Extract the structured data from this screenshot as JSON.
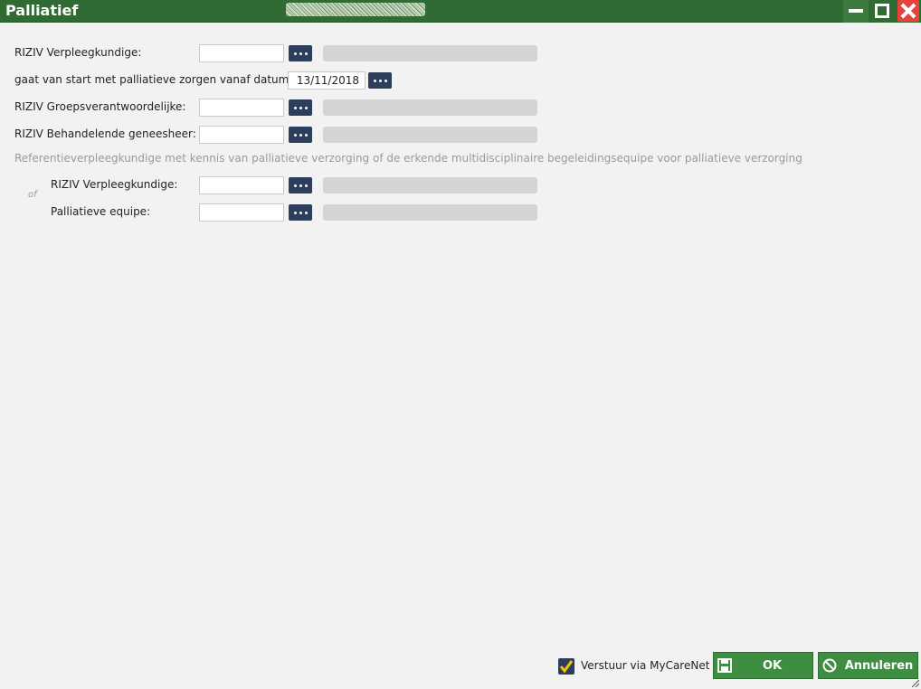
{
  "window": {
    "title": "Palliatief"
  },
  "form": {
    "rows": [
      {
        "label": "RIZIV Verpleegkundige:",
        "value": ""
      },
      {
        "label": "gaat van start met palliatieve zorgen vanaf datum",
        "value": "13/11/2018"
      },
      {
        "label": "RIZIV Groepsverantwoordelijke:",
        "value": ""
      },
      {
        "label": "RIZIV Behandelende geneesheer:",
        "value": ""
      }
    ],
    "note": "Referentieverpleegkundige met kennis van palliatieve verzorging of de erkende multidisciplinaire begeleidingsequipe voor palliatieve verzorging",
    "of_label": "of",
    "sub_rows": [
      {
        "label": "RIZIV Verpleegkundige:",
        "value": ""
      },
      {
        "label": "Palliatieve equipe:",
        "value": ""
      }
    ]
  },
  "footer": {
    "checkbox_label": "Verstuur via MyCareNet",
    "checkbox_checked": true,
    "ok_label": "OK",
    "cancel_label": "Annuleren"
  },
  "colors": {
    "titlebar": "#2f6b33",
    "button": "#3e8e41",
    "lookup_button": "#2c3e5c",
    "close": "#e9413b"
  },
  "icons": [
    "minimize-icon",
    "maximize-icon",
    "close-icon",
    "ellipsis-icon",
    "save-icon",
    "cancel-icon",
    "check-icon",
    "resize-grip-icon"
  ]
}
